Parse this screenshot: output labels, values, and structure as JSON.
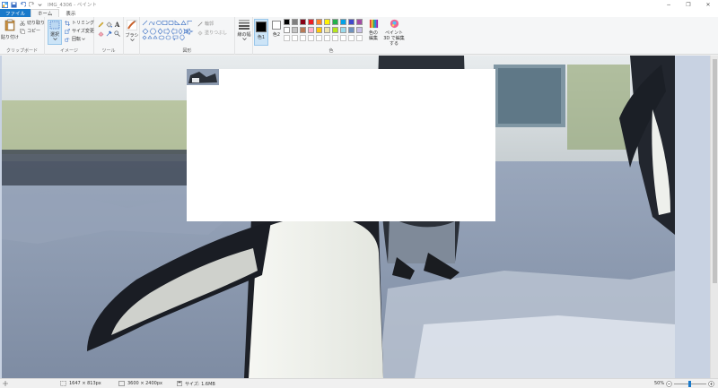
{
  "window": {
    "title": "IMG_4306 - ペイント",
    "minimize": "−",
    "maximize": "❐",
    "close": "✕"
  },
  "tabs": [
    {
      "label": "ファイル"
    },
    {
      "label": "ホーム"
    },
    {
      "label": "表示"
    }
  ],
  "clipboard": {
    "paste": "貼り付け",
    "cut": "切り取り",
    "copy": "コピー",
    "group": "クリップボード"
  },
  "image": {
    "select": "選択",
    "crop": "トリミング",
    "resize": "サイズ変更",
    "rotate": "回転",
    "group": "イメージ"
  },
  "tools": {
    "group": "ツール",
    "brush": "ブラシ"
  },
  "shapes": {
    "group": "図形",
    "outline": "輪郭",
    "fill": "塗りつぶし"
  },
  "line_width": {
    "label": "線の幅"
  },
  "colors": {
    "color1": "色1",
    "color2": "色2",
    "edit": "色の編集",
    "paint3d": "ペイント 3D で編集する",
    "group": "色",
    "color1_value": "#000000",
    "color2_value": "#ffffff",
    "palette_row1": [
      "#000000",
      "#7f7f7f",
      "#880015",
      "#ed1c24",
      "#ff7f27",
      "#fff200",
      "#22b14c",
      "#00a2e8",
      "#3f48cc",
      "#a349a4"
    ],
    "palette_row2": [
      "#ffffff",
      "#c3c3c3",
      "#b97a57",
      "#ffaec9",
      "#ffc90e",
      "#efe4b0",
      "#b5e61d",
      "#99d9ea",
      "#7092be",
      "#c8bfe7"
    ]
  },
  "status": {
    "cursor": "",
    "selection": "1647 × 813px",
    "image_size": "3600 × 2400px",
    "file_size": "サイズ: 1.6MB",
    "zoom": "50%",
    "zoom_percent": 50
  }
}
